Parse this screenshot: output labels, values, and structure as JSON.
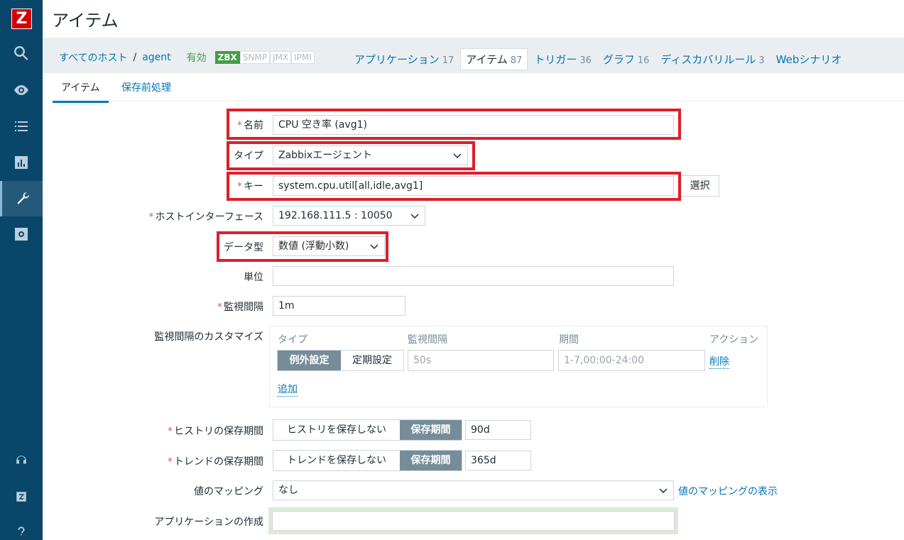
{
  "sidebar": {
    "logo": "Z",
    "icons": [
      "search-icon",
      "eye-icon",
      "list-icon",
      "bar-chart-icon",
      "wrench-icon",
      "gear-icon",
      "headset-icon",
      "zabbix-share-icon",
      "help-icon"
    ]
  },
  "header": {
    "title": "アイテム"
  },
  "host_nav": {
    "all_hosts": "すべてのホスト",
    "separator": "/",
    "host": "agent",
    "status": "有効",
    "tags": [
      "ZBX",
      "SNMP",
      "JMX",
      "IPMI"
    ],
    "tabs": [
      {
        "label": "アプリケーション",
        "count": "17"
      },
      {
        "label": "アイテム",
        "count": "87"
      },
      {
        "label": "トリガー",
        "count": "36"
      },
      {
        "label": "グラフ",
        "count": "16"
      },
      {
        "label": "ディスカバリルール",
        "count": "3"
      },
      {
        "label": "Webシナリオ",
        "count": ""
      }
    ]
  },
  "form_tabs": {
    "item": "アイテム",
    "preprocessing": "保存前処理"
  },
  "form": {
    "name": {
      "label": "名前",
      "value": "CPU 空き率 (avg1)"
    },
    "type": {
      "label": "タイプ",
      "value": "Zabbixエージェント"
    },
    "key": {
      "label": "キー",
      "value": "system.cpu.util[all,idle,avg1]",
      "select_button": "選択"
    },
    "host_interface": {
      "label": "ホストインターフェース",
      "value": "192.168.111.5 : 10050"
    },
    "data_type": {
      "label": "データ型",
      "value": "数値 (浮動小数)"
    },
    "units": {
      "label": "単位",
      "value": ""
    },
    "interval": {
      "label": "監視間隔",
      "value": "1m"
    },
    "custom_intervals": {
      "label": "監視間隔のカスタマイズ",
      "col_type": "タイプ",
      "col_interval": "監視間隔",
      "col_period": "期間",
      "col_action": "アクション",
      "flexible": "例外設定",
      "scheduling": "定期設定",
      "interval_placeholder": "50s",
      "period_placeholder": "1-7,00:00-24:00",
      "remove": "削除",
      "add": "追加"
    },
    "history": {
      "label": "ヒストリの保存期間",
      "no_keep": "ヒストリを保存しない",
      "storage": "保存期間",
      "value": "90d"
    },
    "trends": {
      "label": "トレンドの保存期間",
      "no_keep": "トレンドを保存しない",
      "storage": "保存期間",
      "value": "365d"
    },
    "valuemap": {
      "label": "値のマッピング",
      "value": "なし",
      "show_link": "値のマッピングの表示"
    },
    "new_application": {
      "label": "アプリケーションの作成",
      "value": ""
    }
  },
  "colors": {
    "highlight": "#dd1f2c",
    "sidebar": "#0a466a",
    "link": "#0275b8",
    "enabled": "#429e47"
  }
}
